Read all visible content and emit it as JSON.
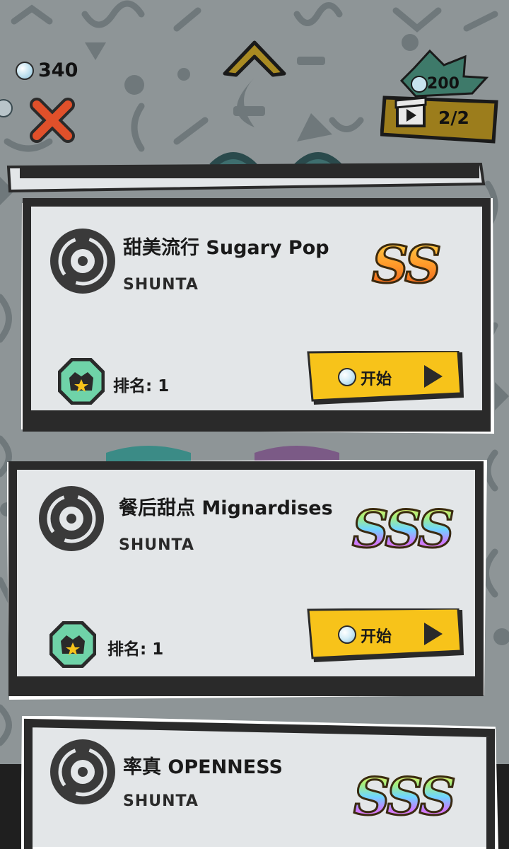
{
  "currency": {
    "gems": "340",
    "icon": "gem-icon"
  },
  "ad_reward": {
    "cost": "200",
    "count": "2/2",
    "icon": "video-ad-icon"
  },
  "colors": {
    "background": "#8e9597",
    "card": "#e3e6e8",
    "card_border": "#2a2a2a",
    "start_button": "#f7c31a",
    "close_x": "#e0502a",
    "rank_badge": "#6fd3a8"
  },
  "songs": [
    {
      "title": "甜美流行 Sugary Pop",
      "artist": "SHUNTA",
      "grade": "SS",
      "rank_label": "排名: 1",
      "start_label": "开始"
    },
    {
      "title": "餐后甜点 Mignardises",
      "artist": "SHUNTA",
      "grade": "SSS",
      "rank_label": "排名: 1",
      "start_label": "开始"
    },
    {
      "title": "率真 OPENNESS",
      "artist": "SHUNTA",
      "grade": "SSS"
    }
  ]
}
